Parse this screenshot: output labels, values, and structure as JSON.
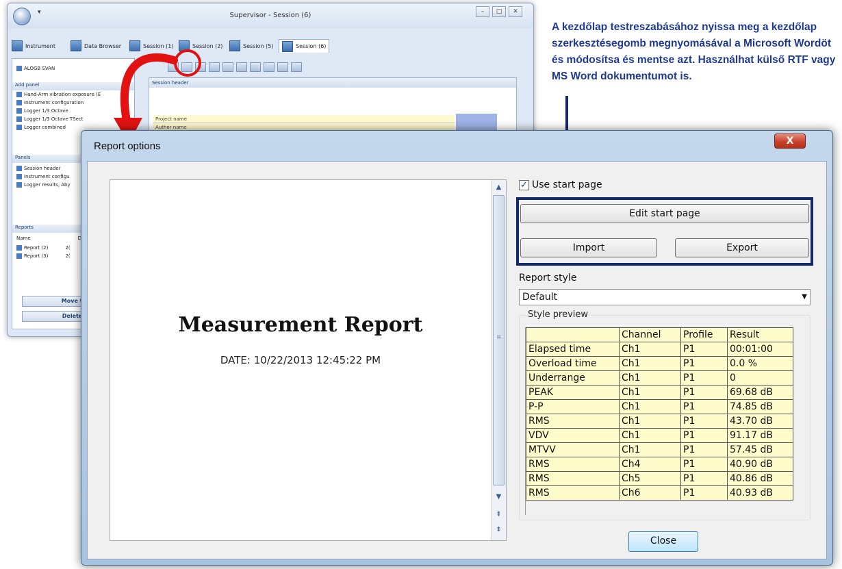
{
  "background_window": {
    "title": "Supervisor - Session (6)",
    "qa_arrow": "▾",
    "window_buttons": [
      "–",
      "□",
      "✕"
    ],
    "tabs": [
      "Instrument",
      "Data Browser",
      "Session (1)",
      "Session (2)",
      "Session (5)",
      "Session (6)"
    ],
    "left_panel": {
      "top_item": "ALOGB SVAN",
      "add_panel_header": "Add panel",
      "add_panel_items": [
        "Hand-Arm vibration exposure (E",
        "Instrument configuration",
        "Logger 1/3 Octave",
        "Logger 1/3 Octave TSect",
        "Logger combined"
      ],
      "panels_header": "Panels",
      "panels_items": [
        "Session header",
        "Instrument configu",
        "Logger results, Aby"
      ],
      "reports_header": "Reports",
      "reports_col": "Name",
      "reports_col2": "Di",
      "reports_items": [
        "Report (2)",
        "Report (3)"
      ],
      "reports_item_suffix": "2(",
      "move_button": "Move to a",
      "delete_button": "Delete se"
    },
    "session_panel": {
      "header": "Session header",
      "fields": [
        "Project name",
        "Author name"
      ]
    }
  },
  "annotation": {
    "text": "A kezdőlap testreszabásához nyissa meg a kezdőlap szerkesztésegomb megnyomásával a Microsoft Wordöt és módosítsa és mentse azt. Használhat külső RTF vagy MS Word dokumentumot is."
  },
  "dialog": {
    "title": "Report options",
    "close_glyph": "X",
    "preview": {
      "title": "Measurement Report",
      "date": "DATE: 10/22/2013 12:45:22 PM"
    },
    "use_start_page": {
      "label": "Use start page",
      "checked": true,
      "check_glyph": "✓"
    },
    "buttons": {
      "edit": "Edit start page",
      "import": "Import",
      "export": "Export",
      "close": "Close"
    },
    "report_style": {
      "label": "Report style",
      "value": "Default"
    },
    "style_preview": {
      "label": "Style preview",
      "columns": [
        "",
        "Channel",
        "Profile",
        "Result"
      ],
      "rows": [
        [
          "Elapsed time",
          "Ch1",
          "P1",
          "00:01:00"
        ],
        [
          "Overload time",
          "Ch1",
          "P1",
          "0.0 %"
        ],
        [
          "Underrange",
          "Ch1",
          "P1",
          "0"
        ],
        [
          "PEAK",
          "Ch1",
          "P1",
          "69.68 dB"
        ],
        [
          "P-P",
          "Ch1",
          "P1",
          "74.85 dB"
        ],
        [
          "RMS",
          "Ch1",
          "P1",
          "43.70 dB"
        ],
        [
          "VDV",
          "Ch1",
          "P1",
          "91.17 dB"
        ],
        [
          "MTVV",
          "Ch1",
          "P1",
          "57.45 dB"
        ],
        [
          "RMS",
          "Ch4",
          "P1",
          "40.90 dB"
        ],
        [
          "RMS",
          "Ch5",
          "P1",
          "40.86 dB"
        ],
        [
          "RMS",
          "Ch6",
          "P1",
          "40.93 dB"
        ]
      ]
    }
  },
  "colors": {
    "annotation_text": "#1f3a93",
    "highlight_border": "#142a66",
    "red_marker": "#e21212",
    "table_cell": "#fffccc"
  }
}
